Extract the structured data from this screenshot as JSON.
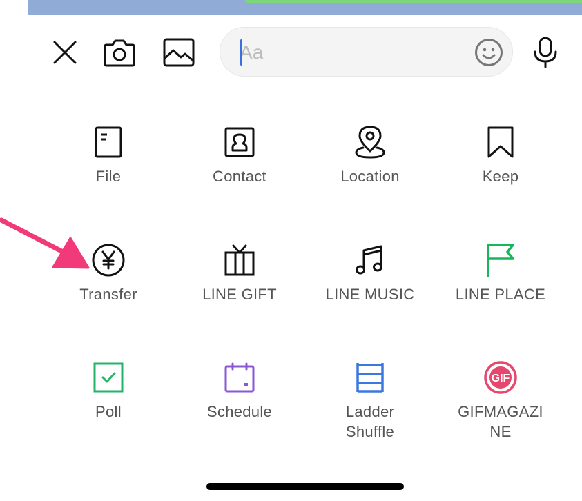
{
  "input": {
    "placeholder": "Aa"
  },
  "menu": {
    "items": [
      {
        "id": "file",
        "label": "File",
        "icon": "file-icon",
        "color": "#111111"
      },
      {
        "id": "contact",
        "label": "Contact",
        "icon": "contact-icon",
        "color": "#111111"
      },
      {
        "id": "location",
        "label": "Location",
        "icon": "location-pin-icon",
        "color": "#111111"
      },
      {
        "id": "keep",
        "label": "Keep",
        "icon": "bookmark-icon",
        "color": "#111111"
      },
      {
        "id": "transfer",
        "label": "Transfer",
        "icon": "yen-coin-icon",
        "color": "#111111"
      },
      {
        "id": "line-gift",
        "label": "LINE GIFT",
        "icon": "gift-icon",
        "color": "#111111"
      },
      {
        "id": "line-music",
        "label": "LINE MUSIC",
        "icon": "music-note-icon",
        "color": "#111111"
      },
      {
        "id": "line-place",
        "label": "LINE PLACE",
        "icon": "flag-icon",
        "color": "#19b55a"
      },
      {
        "id": "poll",
        "label": "Poll",
        "icon": "check-box-icon",
        "color": "#25b36b"
      },
      {
        "id": "schedule",
        "label": "Schedule",
        "icon": "calendar-icon",
        "color": "#8a57d6"
      },
      {
        "id": "ladder-shuffle",
        "label": "Ladder\nShuffle",
        "icon": "ladder-icon",
        "color": "#3b78e0"
      },
      {
        "id": "gifmagazine",
        "label": "GIFMAGAZI\nNE",
        "icon": "gif-badge-icon",
        "color": "#e5476f",
        "badge_text": "GIF"
      }
    ]
  },
  "annotation": {
    "color": "#f23a7a"
  }
}
